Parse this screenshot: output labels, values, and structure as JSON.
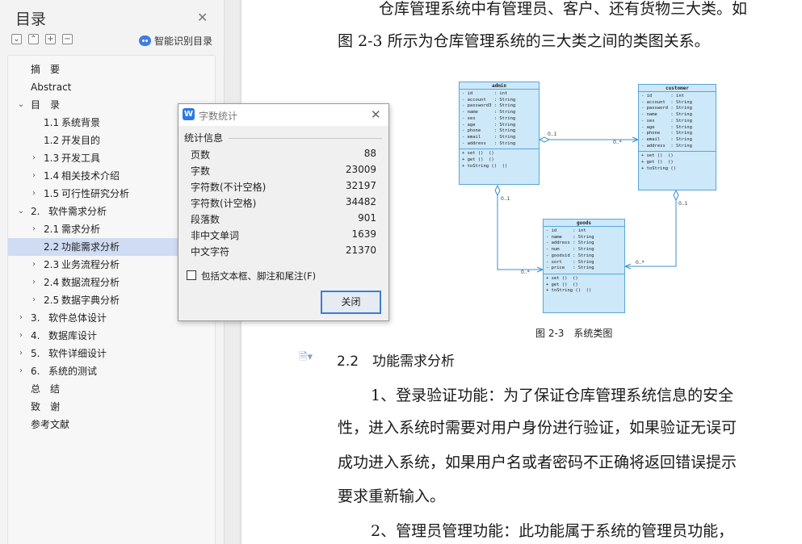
{
  "toc": {
    "title": "目录",
    "smart_toc_label": "智能识别目录",
    "items": [
      {
        "num": "",
        "label": "摘　要",
        "level": 0,
        "arrow": ""
      },
      {
        "num": "",
        "label": "Abstract",
        "level": 0,
        "arrow": ""
      },
      {
        "num": "",
        "label": "目　录",
        "level": 0,
        "arrow": "⌄"
      },
      {
        "num": "1.1",
        "label": "系统背景",
        "level": 1,
        "arrow": ""
      },
      {
        "num": "1.2",
        "label": "开发目的",
        "level": 1,
        "arrow": ""
      },
      {
        "num": "1.3",
        "label": "开发工具",
        "level": 1,
        "arrow": "›"
      },
      {
        "num": "1.4",
        "label": "相关技术介绍",
        "level": 1,
        "arrow": "›"
      },
      {
        "num": "1.5",
        "label": "可行性研究分析",
        "level": 1,
        "arrow": "›"
      },
      {
        "num": "2.",
        "label": "软件需求分析",
        "level": 0,
        "arrow": "⌄"
      },
      {
        "num": "2.1",
        "label": "需求分析",
        "level": 1,
        "arrow": "›"
      },
      {
        "num": "2.2",
        "label": "功能需求分析",
        "level": 1,
        "arrow": "",
        "selected": true
      },
      {
        "num": "2.3",
        "label": "业务流程分析",
        "level": 1,
        "arrow": "›"
      },
      {
        "num": "2.4",
        "label": "数据流程分析",
        "level": 1,
        "arrow": "›"
      },
      {
        "num": "2.5",
        "label": "数据字典分析",
        "level": 1,
        "arrow": "›"
      },
      {
        "num": "3.",
        "label": "软件总体设计",
        "level": 0,
        "arrow": "›"
      },
      {
        "num": "4.",
        "label": "数据库设计",
        "level": 0,
        "arrow": "›"
      },
      {
        "num": "5.",
        "label": "软件详细设计",
        "level": 0,
        "arrow": "›"
      },
      {
        "num": "6.",
        "label": "系统的测试",
        "level": 0,
        "arrow": "›"
      },
      {
        "num": "",
        "label": "总　结",
        "level": 0,
        "arrow": ""
      },
      {
        "num": "",
        "label": "致　谢",
        "level": 0,
        "arrow": ""
      },
      {
        "num": "",
        "label": "参考文献",
        "level": 0,
        "arrow": ""
      }
    ]
  },
  "dialog": {
    "title": "字数统计",
    "group_label": "统计信息",
    "stats": [
      {
        "label": "页数",
        "value": "88"
      },
      {
        "label": "字数",
        "value": "23009"
      },
      {
        "label": "字符数(不计空格)",
        "value": "32197"
      },
      {
        "label": "字符数(计空格)",
        "value": "34482"
      },
      {
        "label": "段落数",
        "value": "901"
      },
      {
        "label": "非中文单词",
        "value": "1639"
      },
      {
        "label": "中文字符",
        "value": "21370"
      }
    ],
    "checkbox_label": "包括文本框、脚注和尾注(F)",
    "close_button": "关闭"
  },
  "document": {
    "para1_line1": "仓库管理系统中有管理员、客户、还有货物三大类。如",
    "para1_line2": "图 2-3 所示为仓库管理系统的三大类之间的类图关系。",
    "figure_caption": "图 2-3　系统类图",
    "heading": "2.2　功能需求分析",
    "para2_line1": "1、登录验证功能：为了保证仓库管理系统信息的安全",
    "para2_line2": "性，进入系统时需要对用户身份进行验证，如果验证无误可",
    "para2_line3": "成功进入系统，如果用户名或者密码不正确将返回错误提示",
    "para2_line4": "要求重新输入。",
    "para3_line1": "2、管理员管理功能：此功能属于系统的管理员功能，"
  },
  "uml": {
    "admin": {
      "name": "admin",
      "attributes": [
        "- id        : int",
        "- account   : String",
        "- password3 : String",
        "- name      : String",
        "- sex       : String",
        "- age       : String",
        "- phone     : String",
        "- email     : String",
        "- address   : String"
      ],
      "methods": [
        "+ set ()  ()",
        "+ get ()  ()",
        "+ toString ()  ()"
      ]
    },
    "customer": {
      "name": "customer",
      "attributes": [
        "- id       : int",
        "- account  : String",
        "- password : String",
        "- name     : String",
        "- sex      : String",
        "- age      : String",
        "- phone    : String",
        "- email    : String",
        "- address  : String"
      ],
      "methods": [
        "+ set ()  ()",
        "+ get ()  ()",
        "+ toString ()"
      ]
    },
    "goods": {
      "name": "goods",
      "attributes": [
        "- id      : int",
        "- name    : String",
        "- address : String",
        "- num     : String",
        "- goodsid : String",
        "- sort    : String",
        "- price   : String"
      ],
      "methods": [
        "+ set ()  ()",
        "+ get ()  ()",
        "+ toString ()  ()"
      ]
    },
    "multiplicities": {
      "admin_customer_a": "0..1",
      "admin_customer_b": "0..*",
      "admin_goods_a": "0..1",
      "admin_goods_b": "0..*",
      "customer_goods_a": "0..1",
      "customer_goods_b": "0..*"
    }
  }
}
